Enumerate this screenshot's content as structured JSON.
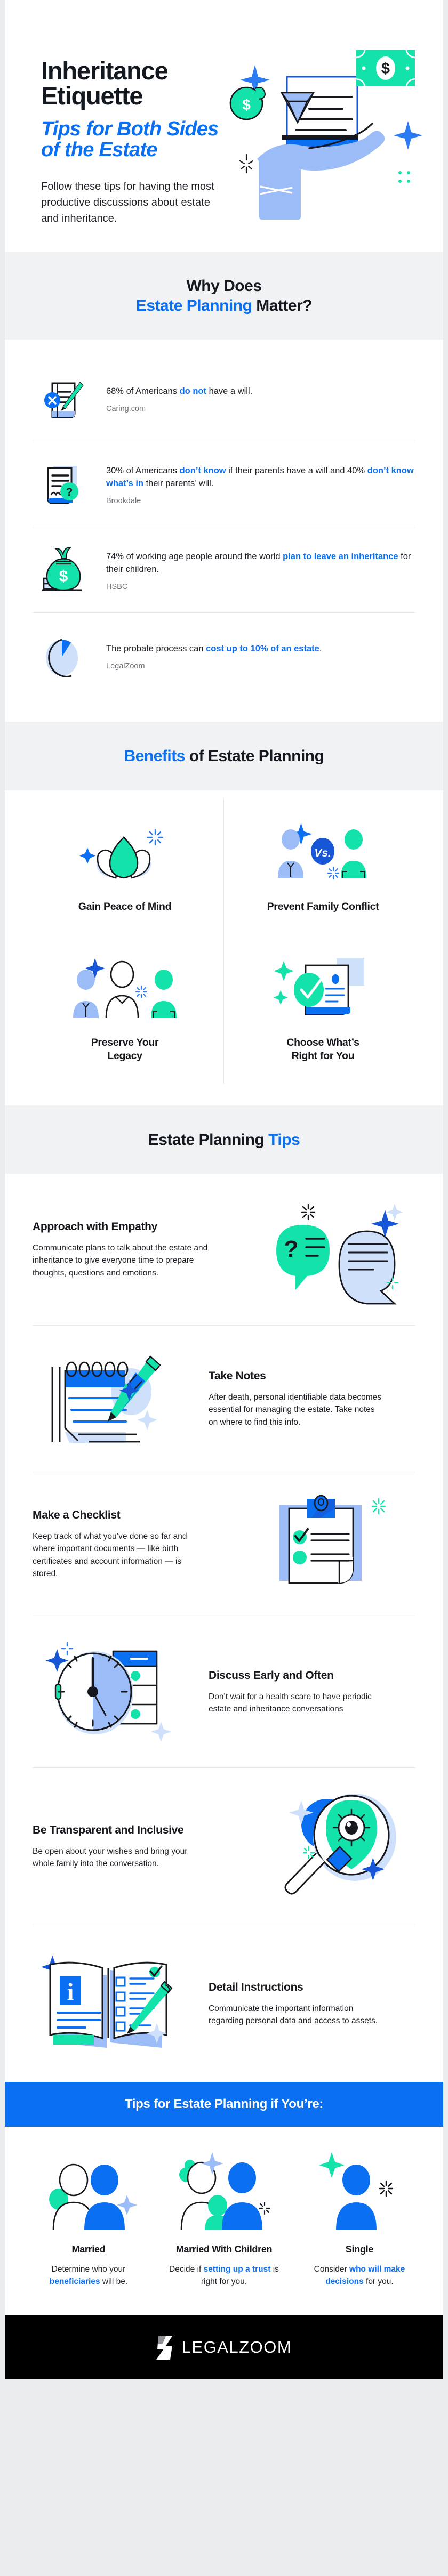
{
  "hero": {
    "title_line1": "Inheritance",
    "title_line2": "Etiquette",
    "subtitle_line1": "Tips for Both Sides",
    "subtitle_line2": "of the Estate",
    "body": "Follow these tips for having the most productive discussions about estate and inheritance."
  },
  "why_section": {
    "heading_line1": "Why Does",
    "heading_line2_blue": "Estate Planning",
    "heading_line2_rest": " Matter?",
    "stats": [
      {
        "icon": "document-x-pencil-icon",
        "text_before": "68% of Americans ",
        "text_highlight": "do not",
        "text_after": " have a will.",
        "source": "Caring.com"
      },
      {
        "icon": "document-question-icon",
        "text_before": "30% of Americans ",
        "text_highlight": "don’t know",
        "text_after": " if their parents have a will and 40% ",
        "text_highlight2": "don’t know what’s in",
        "text_after2": " their parents’ will.",
        "source": "Brookdale"
      },
      {
        "icon": "money-bag-icon",
        "text_before": "74% of working age people around the world ",
        "text_highlight": "plan to leave an inheritance",
        "text_after": " for their children.",
        "source": "HSBC"
      },
      {
        "icon": "pie-chart-icon",
        "text_before": "The probate process can ",
        "text_highlight": "cost up to 10% of an estate",
        "text_after": ".",
        "source": "LegalZoom"
      }
    ]
  },
  "benefits_section": {
    "heading_blue": "Benefits",
    "heading_rest": " of Estate Planning",
    "items": [
      {
        "icon": "lotus-flower-icon",
        "label": "Gain Peace of Mind"
      },
      {
        "icon": "two-people-versus-icon",
        "label": "Prevent Family Conflict"
      },
      {
        "icon": "three-people-icon",
        "label": "Preserve Your\nLegacy"
      },
      {
        "icon": "document-check-icon",
        "label": "Choose What’s\nRight for You"
      }
    ]
  },
  "tips_section": {
    "heading_rest": "Estate Planning ",
    "heading_blue": "Tips",
    "tips": [
      {
        "icon": "speech-bubbles-icon",
        "title": "Approach with Empathy",
        "body": "Communicate plans to talk about the estate and inheritance to give everyone time to prepare thoughts, questions and emotions.",
        "layout": "text-left"
      },
      {
        "icon": "notepad-pencil-icon",
        "title": "Take Notes",
        "body": "After death, personal identifiable data becomes essential for managing the estate. Take notes on where to find this info.",
        "layout": "art-left"
      },
      {
        "icon": "clipboard-check-icon",
        "title": "Make a Checklist",
        "body": "Keep track of what you’ve done so far and where important documents — like birth certificates and account information — is stored.",
        "layout": "text-left"
      },
      {
        "icon": "clock-calendar-icon",
        "title": "Discuss Early and Often",
        "body": "Don’t wait for a health scare to have periodic estate and inheritance conversations",
        "layout": "art-left"
      },
      {
        "icon": "magnifier-eye-icon",
        "title": "Be Transparent and Inclusive",
        "body": "Be open about your wishes and bring your whole family into the conversation.",
        "layout": "text-left"
      },
      {
        "icon": "open-book-pencil-icon",
        "title": "Detail Instructions",
        "body": "Communicate the important information regarding personal data and access to assets.",
        "layout": "art-left"
      }
    ]
  },
  "audience_section": {
    "banner": "Tips for Estate Planning if You’re:",
    "items": [
      {
        "icon": "couple-icon",
        "label": "Married",
        "text_before": "Determine who your ",
        "text_highlight": "beneficiaries",
        "text_after": " will be."
      },
      {
        "icon": "family-icon",
        "label": "Married With Children",
        "text_before": "Decide if ",
        "text_highlight": "setting up a trust",
        "text_after": " is right for you."
      },
      {
        "icon": "single-person-icon",
        "label": "Single",
        "text_before": "Consider ",
        "text_highlight": "who will make decisions",
        "text_after": " for you."
      }
    ]
  },
  "footer": {
    "logo_mark": "legalzoom-z-mark",
    "wordmark": "LEGALZOOM"
  },
  "colors": {
    "accent_blue": "#0a6ff0",
    "accent_green": "#13e3ab",
    "light_blue": "#9bbcf7",
    "pale_blue": "#cfe0fb",
    "band_bg": "#f0f2f4",
    "ink": "#16181d",
    "footer_bg": "#000000"
  }
}
